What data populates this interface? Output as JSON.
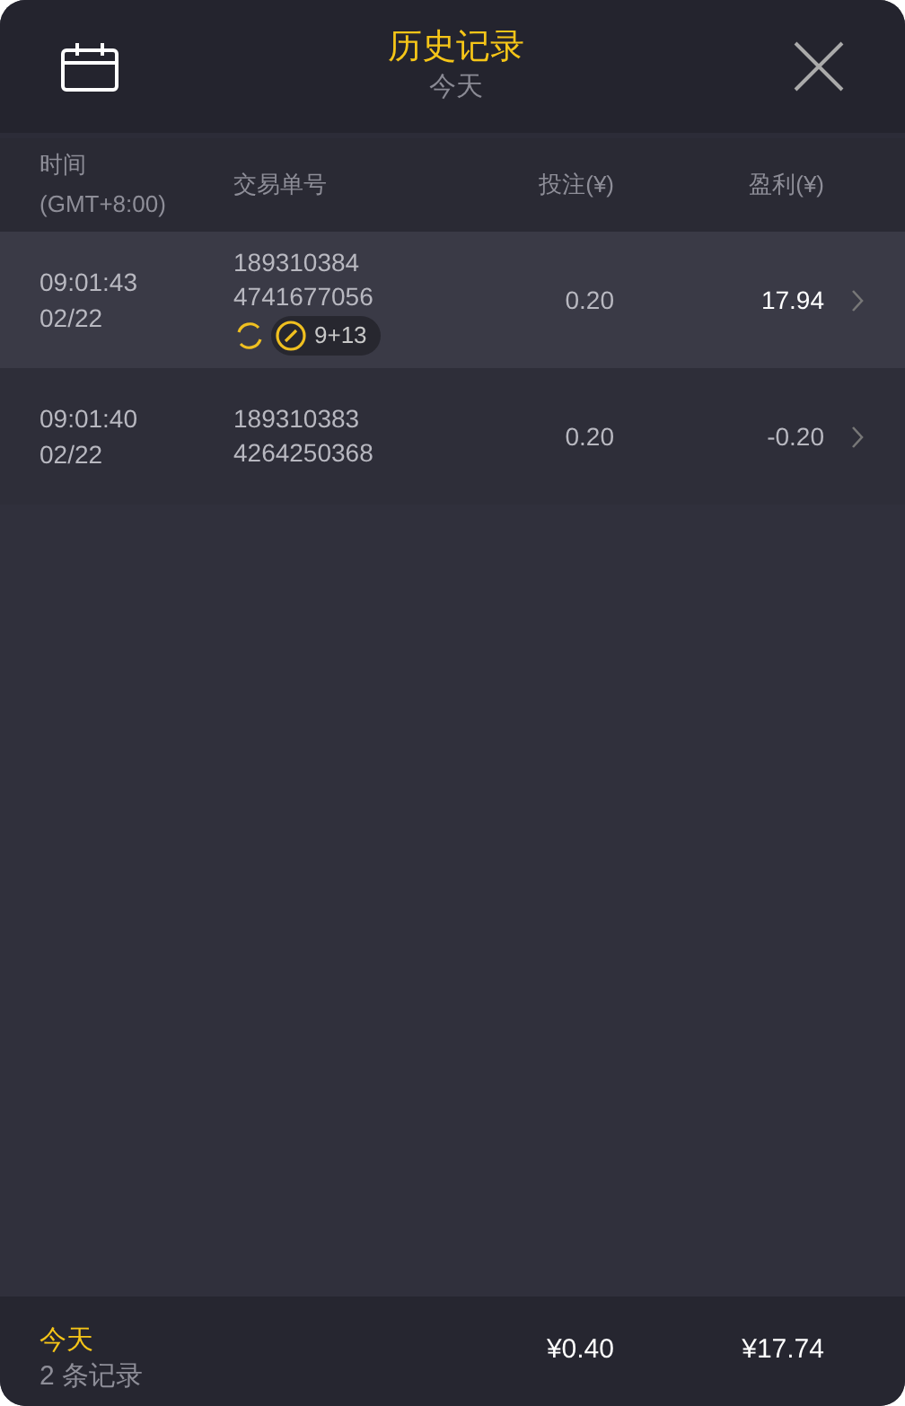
{
  "header": {
    "title": "历史记录",
    "subtitle": "今天"
  },
  "columns": [
    {
      "line1": "时间",
      "line2": "(GMT+8:00)"
    },
    {
      "line1": "交易单号"
    },
    {
      "line1": "投注(¥)"
    },
    {
      "line1": "盈利(¥)"
    }
  ],
  "rows": [
    {
      "time": "09:01:43",
      "date": "02/22",
      "order_1": "189310384",
      "order_2": "4741677056",
      "bet": "0.20",
      "profit": "17.94",
      "positive": true,
      "selected": true,
      "badges": [
        {
          "kind": "refresh"
        },
        {
          "kind": "combo",
          "text": "9+13"
        }
      ]
    },
    {
      "time": "09:01:40",
      "date": "02/22",
      "order_1": "189310383",
      "order_2": "4264250368",
      "bet": "0.20",
      "profit": "-0.20",
      "positive": false,
      "selected": false,
      "badges": []
    }
  ],
  "footer": {
    "period": "今天",
    "count": "2 条记录",
    "total_bet": "¥0.40",
    "total_profit": "¥17.74"
  }
}
